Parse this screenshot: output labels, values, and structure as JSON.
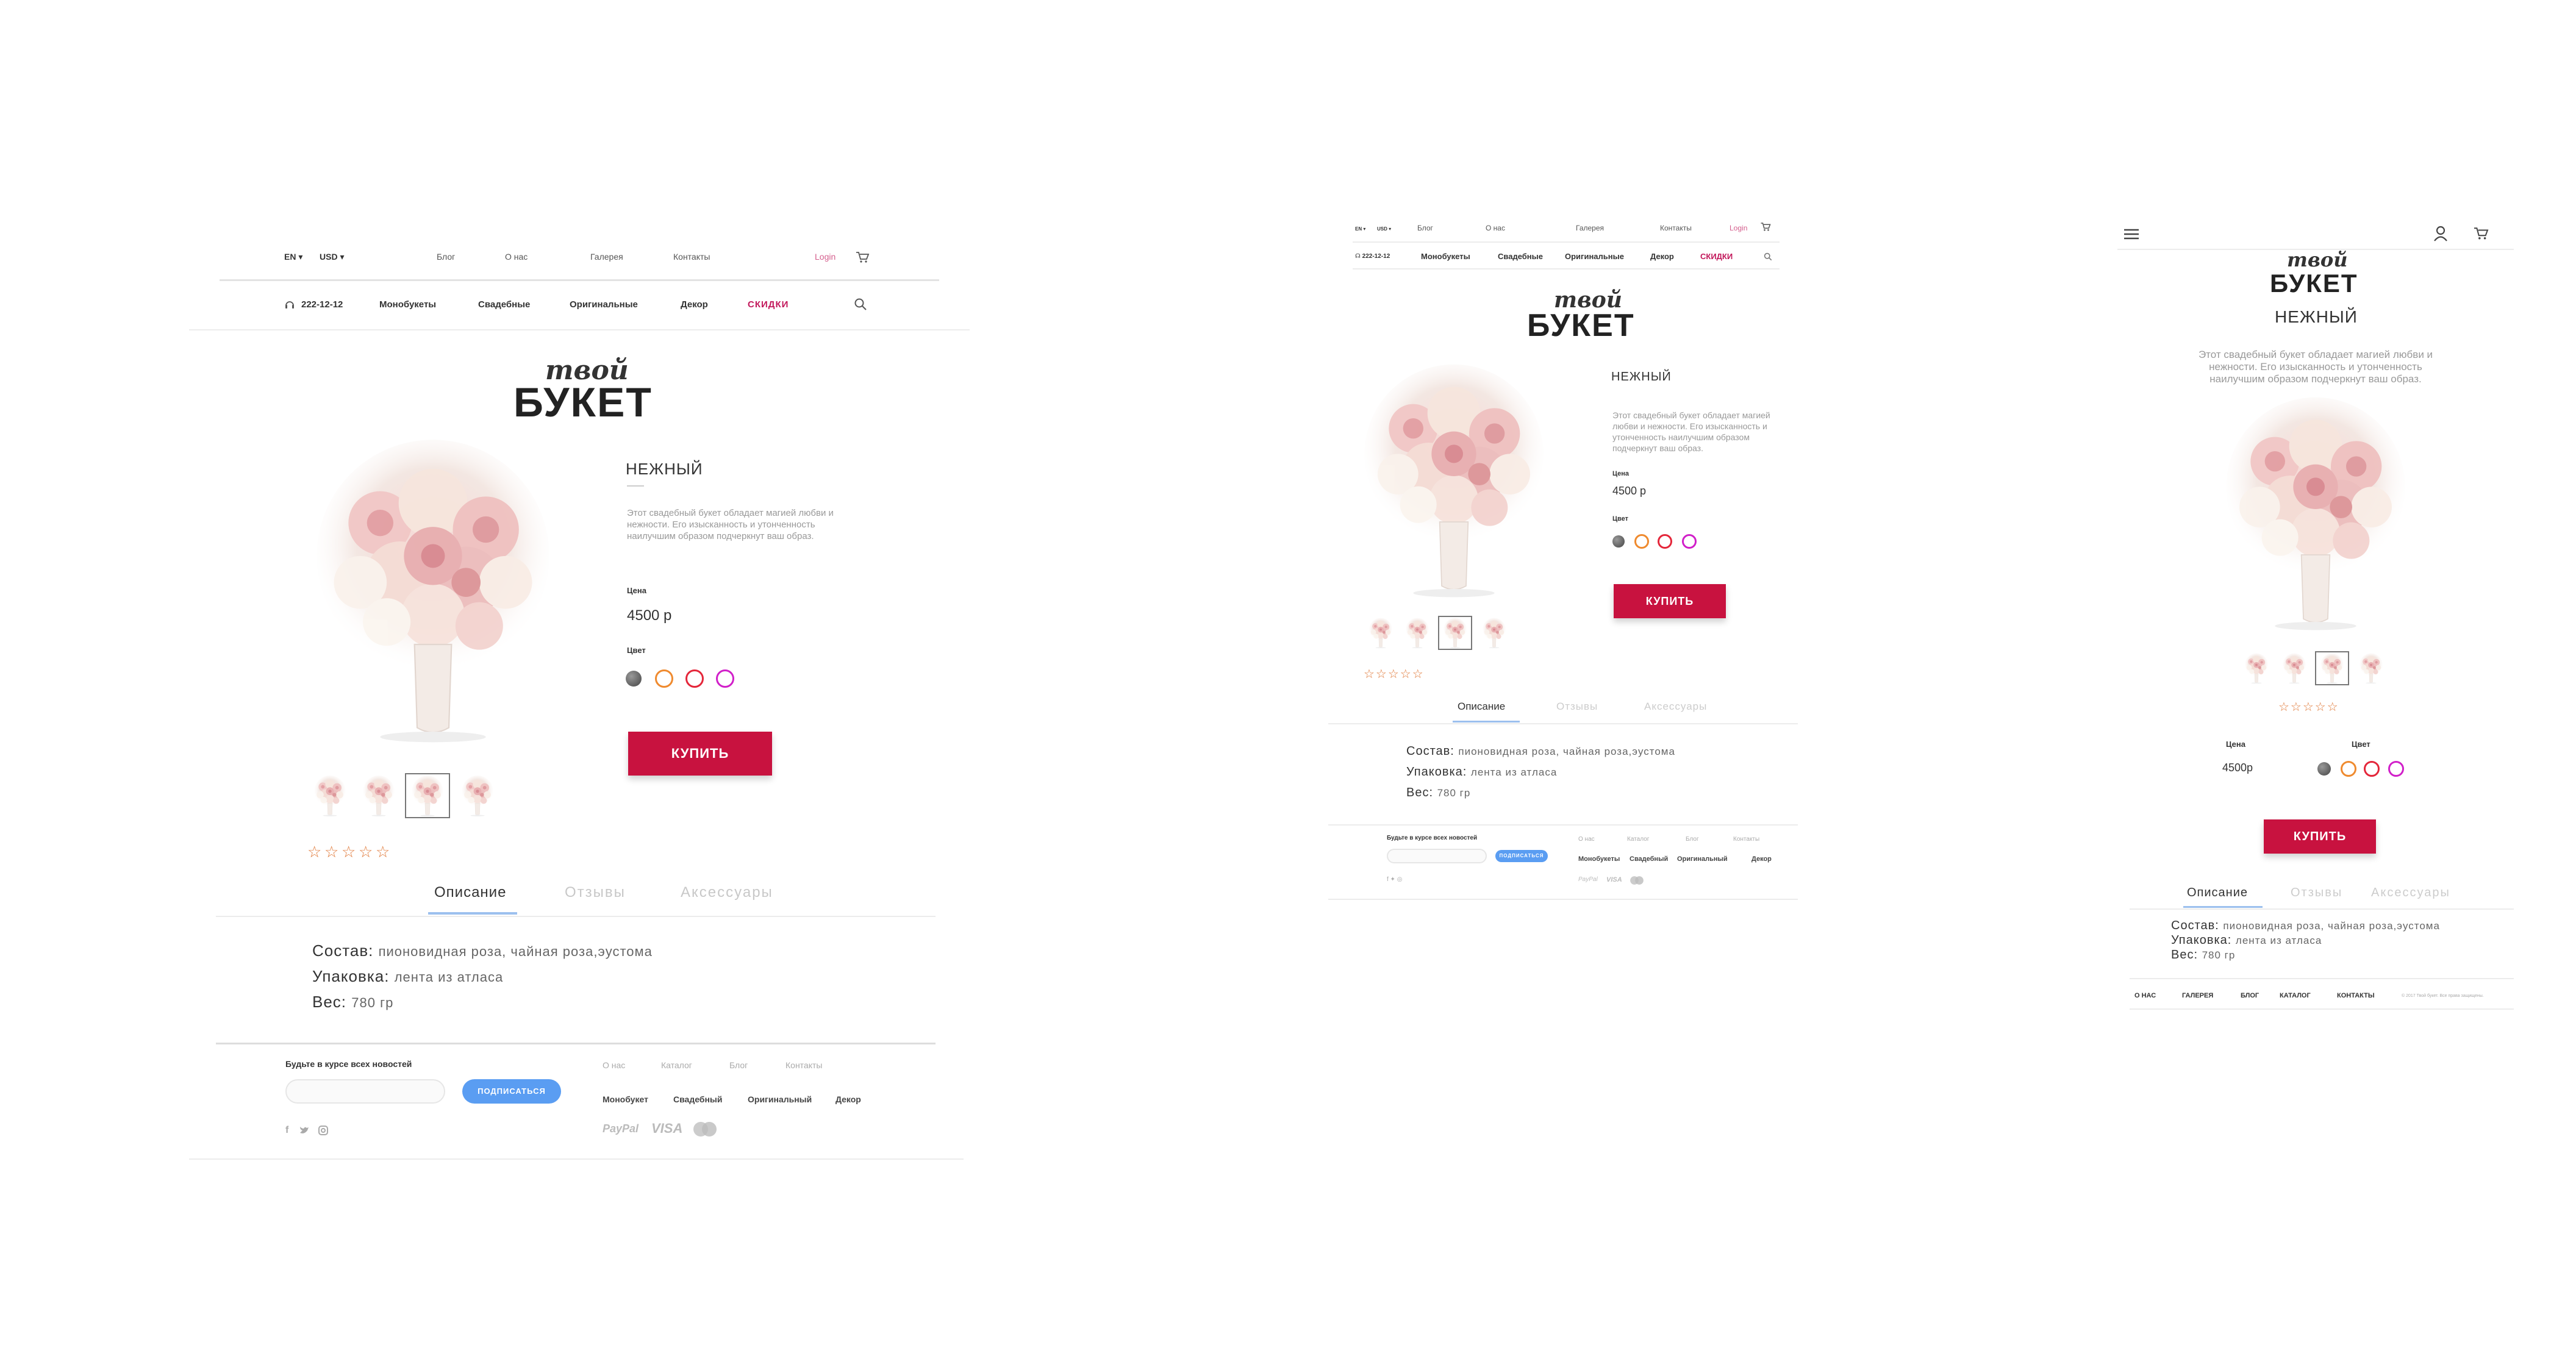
{
  "lang": "EN",
  "currency": "USD",
  "nav_top": [
    "Блог",
    "О нас",
    "Галерея",
    "Контакты"
  ],
  "login": "Login",
  "phone": "222-12-12",
  "nav_main": [
    "Монобукеты",
    "Свадебные",
    "Оригинальные",
    "Декор"
  ],
  "sale": "СКИДКИ",
  "title_script": "твой",
  "title_main": "БУКЕТ",
  "product_name": "НЕЖНЫЙ",
  "description": "Этот свадебный букет обладает магией любви и нежности. Его изысканность и утонченность наилучшим образом подчеркнут ваш образ.",
  "price_label": "Цена",
  "price": "4500 р",
  "price_short": "4500р",
  "color_label": "Цвет",
  "colors": [
    "#666666",
    "#ef8a2e",
    "#e4263a",
    "#d11fc9"
  ],
  "buy": "КУПИТЬ",
  "rating": 0,
  "tabs": [
    "Описание",
    "Отзывы",
    "Аксессуары"
  ],
  "composition_label": "Состав:",
  "composition": "пионовидная роза, чайная роза,эустома",
  "packaging_label": "Упаковка:",
  "packaging": "лента из атласа",
  "weight_label": "Вес:",
  "weight": "780 гр",
  "newsletter": "Будьте в курсе всех новостей",
  "subscribe": "ПОДПИСАТЬСЯ",
  "footer_top": [
    "О нас",
    "Каталог",
    "Блог",
    "Контакты"
  ],
  "footer_cats": [
    "Монобукет",
    "Свадебный",
    "Оригинальный",
    "Декор"
  ],
  "footer_cats_mid": [
    "Монобукеты",
    "Свадебный",
    "Оригинальный",
    "Декор"
  ],
  "payments": [
    "PayPal",
    "VISA"
  ],
  "mobile_footer": [
    "О НАС",
    "ГАЛЕРЕЯ",
    "БЛОГ",
    "КАТАЛОГ",
    "КОНТАКТЫ"
  ],
  "mobile_copyright": "© 2017 Твой букет. Все права защищены."
}
